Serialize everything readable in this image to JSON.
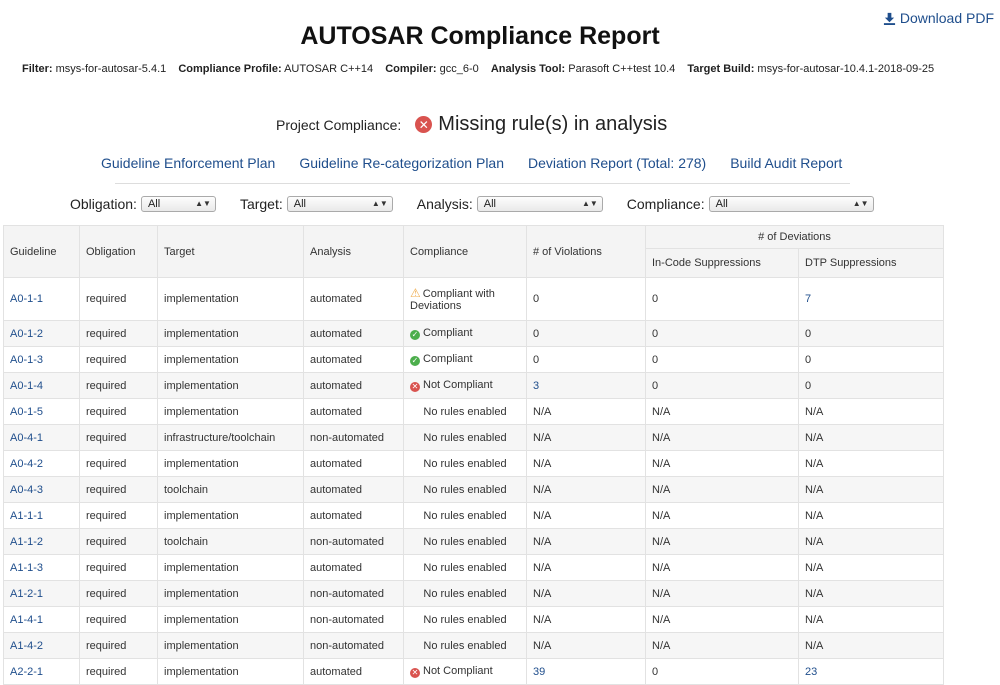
{
  "download": {
    "label": "Download PDF"
  },
  "title": "AUTOSAR Compliance Report",
  "meta": [
    {
      "label": "Filter:",
      "value": "msys-for-autosar-5.4.1"
    },
    {
      "label": "Compliance Profile:",
      "value": "AUTOSAR C++14"
    },
    {
      "label": "Compiler:",
      "value": "gcc_6-0"
    },
    {
      "label": "Analysis Tool:",
      "value": "Parasoft C++test 10.4"
    },
    {
      "label": "Target Build:",
      "value": "msys-for-autosar-10.4.1-2018-09-25"
    }
  ],
  "project_compliance": {
    "label": "Project Compliance:",
    "status": "Missing rule(s) in analysis"
  },
  "links": [
    "Guideline Enforcement Plan",
    "Guideline Re-categorization Plan",
    "Deviation Report (Total: 278)",
    "Build Audit Report"
  ],
  "filters": {
    "obligation": {
      "label": "Obligation:",
      "value": "All"
    },
    "target": {
      "label": "Target:",
      "value": "All"
    },
    "analysis": {
      "label": "Analysis:",
      "value": "All"
    },
    "compliance": {
      "label": "Compliance:",
      "value": "All"
    }
  },
  "table": {
    "group_header": "# of Deviations",
    "headers": [
      "Guideline",
      "Obligation",
      "Target",
      "Analysis",
      "Compliance",
      "# of Violations",
      "In-Code Suppressions",
      "DTP Suppressions"
    ],
    "rows": [
      {
        "guideline": "A0-1-1",
        "obligation": "required",
        "target": "implementation",
        "analysis": "automated",
        "compliance": "Compliant with Deviations",
        "status": "warn",
        "violations": "0",
        "incode": "0",
        "dtp": "7"
      },
      {
        "guideline": "A0-1-2",
        "obligation": "required",
        "target": "implementation",
        "analysis": "automated",
        "compliance": "Compliant",
        "status": "ok",
        "violations": "0",
        "incode": "0",
        "dtp": "0"
      },
      {
        "guideline": "A0-1-3",
        "obligation": "required",
        "target": "implementation",
        "analysis": "automated",
        "compliance": "Compliant",
        "status": "ok",
        "violations": "0",
        "incode": "0",
        "dtp": "0"
      },
      {
        "guideline": "A0-1-4",
        "obligation": "required",
        "target": "implementation",
        "analysis": "automated",
        "compliance": "Not Compliant",
        "status": "err",
        "violations": "3",
        "incode": "0",
        "dtp": "0"
      },
      {
        "guideline": "A0-1-5",
        "obligation": "required",
        "target": "implementation",
        "analysis": "automated",
        "compliance": "No rules enabled",
        "status": "none",
        "violations": "N/A",
        "incode": "N/A",
        "dtp": "N/A"
      },
      {
        "guideline": "A0-4-1",
        "obligation": "required",
        "target": "infrastructure/toolchain",
        "analysis": "non-automated",
        "compliance": "No rules enabled",
        "status": "none",
        "violations": "N/A",
        "incode": "N/A",
        "dtp": "N/A"
      },
      {
        "guideline": "A0-4-2",
        "obligation": "required",
        "target": "implementation",
        "analysis": "automated",
        "compliance": "No rules enabled",
        "status": "none",
        "violations": "N/A",
        "incode": "N/A",
        "dtp": "N/A"
      },
      {
        "guideline": "A0-4-3",
        "obligation": "required",
        "target": "toolchain",
        "analysis": "automated",
        "compliance": "No rules enabled",
        "status": "none",
        "violations": "N/A",
        "incode": "N/A",
        "dtp": "N/A"
      },
      {
        "guideline": "A1-1-1",
        "obligation": "required",
        "target": "implementation",
        "analysis": "automated",
        "compliance": "No rules enabled",
        "status": "none",
        "violations": "N/A",
        "incode": "N/A",
        "dtp": "N/A"
      },
      {
        "guideline": "A1-1-2",
        "obligation": "required",
        "target": "toolchain",
        "analysis": "non-automated",
        "compliance": "No rules enabled",
        "status": "none",
        "violations": "N/A",
        "incode": "N/A",
        "dtp": "N/A"
      },
      {
        "guideline": "A1-1-3",
        "obligation": "required",
        "target": "implementation",
        "analysis": "automated",
        "compliance": "No rules enabled",
        "status": "none",
        "violations": "N/A",
        "incode": "N/A",
        "dtp": "N/A"
      },
      {
        "guideline": "A1-2-1",
        "obligation": "required",
        "target": "implementation",
        "analysis": "non-automated",
        "compliance": "No rules enabled",
        "status": "none",
        "violations": "N/A",
        "incode": "N/A",
        "dtp": "N/A"
      },
      {
        "guideline": "A1-4-1",
        "obligation": "required",
        "target": "implementation",
        "analysis": "non-automated",
        "compliance": "No rules enabled",
        "status": "none",
        "violations": "N/A",
        "incode": "N/A",
        "dtp": "N/A"
      },
      {
        "guideline": "A1-4-2",
        "obligation": "required",
        "target": "implementation",
        "analysis": "non-automated",
        "compliance": "No rules enabled",
        "status": "none",
        "violations": "N/A",
        "incode": "N/A",
        "dtp": "N/A"
      },
      {
        "guideline": "A2-2-1",
        "obligation": "required",
        "target": "implementation",
        "analysis": "automated",
        "compliance": "Not Compliant",
        "status": "err",
        "violations": "39",
        "incode": "0",
        "dtp": "23"
      }
    ]
  }
}
